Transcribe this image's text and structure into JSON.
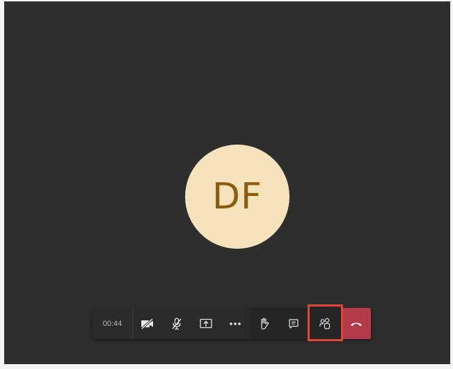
{
  "call": {
    "avatar_initials": "DF",
    "avatar_bg": "#f6e3bb",
    "avatar_fg": "#8a5d12",
    "elapsed": "00:44"
  },
  "toolbar": {
    "buttons": [
      {
        "name": "camera-off",
        "icon": "video-off-icon"
      },
      {
        "name": "mic-muted",
        "icon": "mic-off-icon"
      },
      {
        "name": "share-screen",
        "icon": "share-tray-icon"
      },
      {
        "name": "more-actions",
        "icon": "more-dots-icon"
      },
      {
        "name": "raise-hand",
        "icon": "hand-icon"
      },
      {
        "name": "show-conversation",
        "icon": "chat-icon"
      },
      {
        "name": "show-participants",
        "icon": "people-icon",
        "highlighted": true
      },
      {
        "name": "hang-up",
        "icon": "phone-hangup-icon",
        "color": "#b33a49"
      }
    ],
    "highlight_color": "#e0453a"
  }
}
